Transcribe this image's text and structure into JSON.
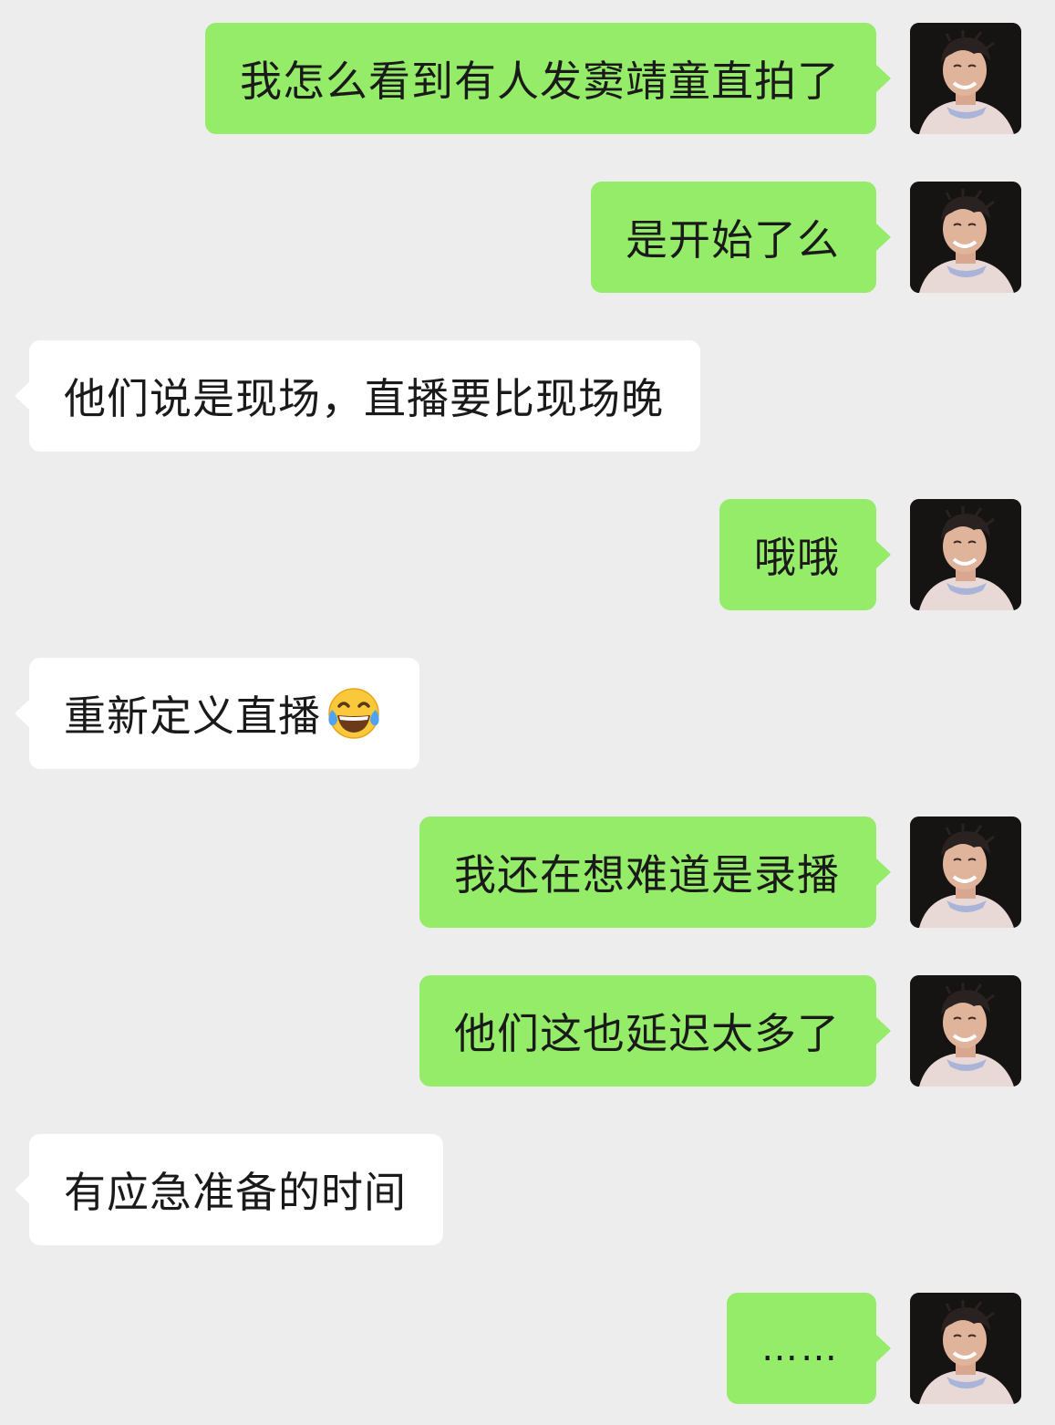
{
  "chat": {
    "messages": [
      {
        "side": "out",
        "text": "我怎么看到有人发窦靖童直拍了"
      },
      {
        "side": "out",
        "text": "是开始了么"
      },
      {
        "side": "in",
        "text": "他们说是现场，直播要比现场晚"
      },
      {
        "side": "out",
        "text": "哦哦"
      },
      {
        "side": "in",
        "text": "重新定义直播",
        "emoji": "tears-of-joy-emoji"
      },
      {
        "side": "out",
        "text": "我还在想难道是录播"
      },
      {
        "side": "out",
        "text": "他们这也延迟太多了"
      },
      {
        "side": "in",
        "text": "有应急准备的时间"
      },
      {
        "side": "out",
        "text": "……"
      }
    ]
  },
  "colors": {
    "background": "#ededed",
    "outgoing_bubble": "#95ec69",
    "incoming_bubble": "#ffffff",
    "text": "#1a1a1a"
  }
}
